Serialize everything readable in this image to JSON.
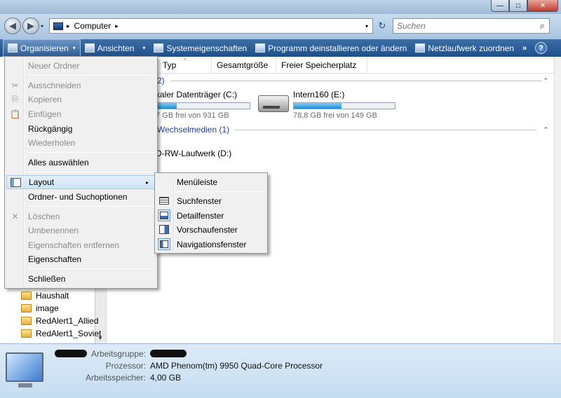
{
  "window": {
    "min_label": "—",
    "max_label": "□",
    "close_label": "✕"
  },
  "address": {
    "crumb_separator": "▸",
    "path": "Computer",
    "crumb_arrow": "▸",
    "dropdown_arrow": "▾",
    "refresh_icon": "↻"
  },
  "search": {
    "placeholder": "Suchen",
    "icon": "⌕"
  },
  "nav": {
    "back_icon": "◀",
    "forward_icon": "▶",
    "dropdown": "▾"
  },
  "toolbar": {
    "organize_label": "Organisieren",
    "views_label": "Ansichten",
    "system_props_label": "Systemeigenschaften",
    "uninstall_label": "Programm deinstallieren oder ändern",
    "map_drive_label": "Netzlaufwerk zuordnen",
    "more_label": "»",
    "help_label": "?",
    "dropdown_arrow": "▾"
  },
  "columns": {
    "type": "Typ",
    "total": "Gesamtgröße",
    "free": "Freier Speicherplatz",
    "sort_arrow": "^"
  },
  "groups": {
    "hdd_label": "2)",
    "removable_label": "Wechselmedien (1)",
    "collapse_icon": "⌃"
  },
  "drives": [
    {
      "name": "kaler Datenträger (C:)",
      "free_text": "7 GB frei von 931 GB",
      "used_fraction": 0.22
    },
    {
      "name": "Intern160 (E:)",
      "free_text": "78,8 GB frei von 149 GB",
      "used_fraction": 0.47
    }
  ],
  "removable": {
    "name": "D-RW-Laufwerk (D:)"
  },
  "folders": [
    "Haushalt",
    "image",
    "RedAlert1_Allied",
    "RedAlert1_Soviet"
  ],
  "menu": {
    "new_folder": "Neuer Ordner",
    "cut": "Ausschneiden",
    "copy": "Kopieren",
    "paste": "Einfügen",
    "undo": "Rückgängig",
    "redo": "Wiederholen",
    "select_all": "Alles auswählen",
    "layout": "Layout",
    "layout_arrow": "▸",
    "folder_options": "Ordner- und Suchoptionen",
    "delete": "Löschen",
    "rename": "Umbenennen",
    "remove_props": "Eigenschaften entfernen",
    "properties": "Eigenschaften",
    "close": "Schließen",
    "cut_icon": "✂",
    "copy_icon": "⎘",
    "paste_icon": "📋",
    "delete_icon": "✕"
  },
  "submenu": {
    "menubar": "Menüleiste",
    "search_pane": "Suchfenster",
    "details_pane": "Detailfenster",
    "preview_pane": "Vorschaufenster",
    "nav_pane": "Navigationsfenster"
  },
  "details": {
    "workgroup_label": "Arbeitsgruppe:",
    "processor_label": "Prozessor:",
    "processor_value": "AMD Phenom(tm) 9950 Quad-Core Processor",
    "memory_label": "Arbeitsspeicher:",
    "memory_value": "4,00 GB"
  }
}
